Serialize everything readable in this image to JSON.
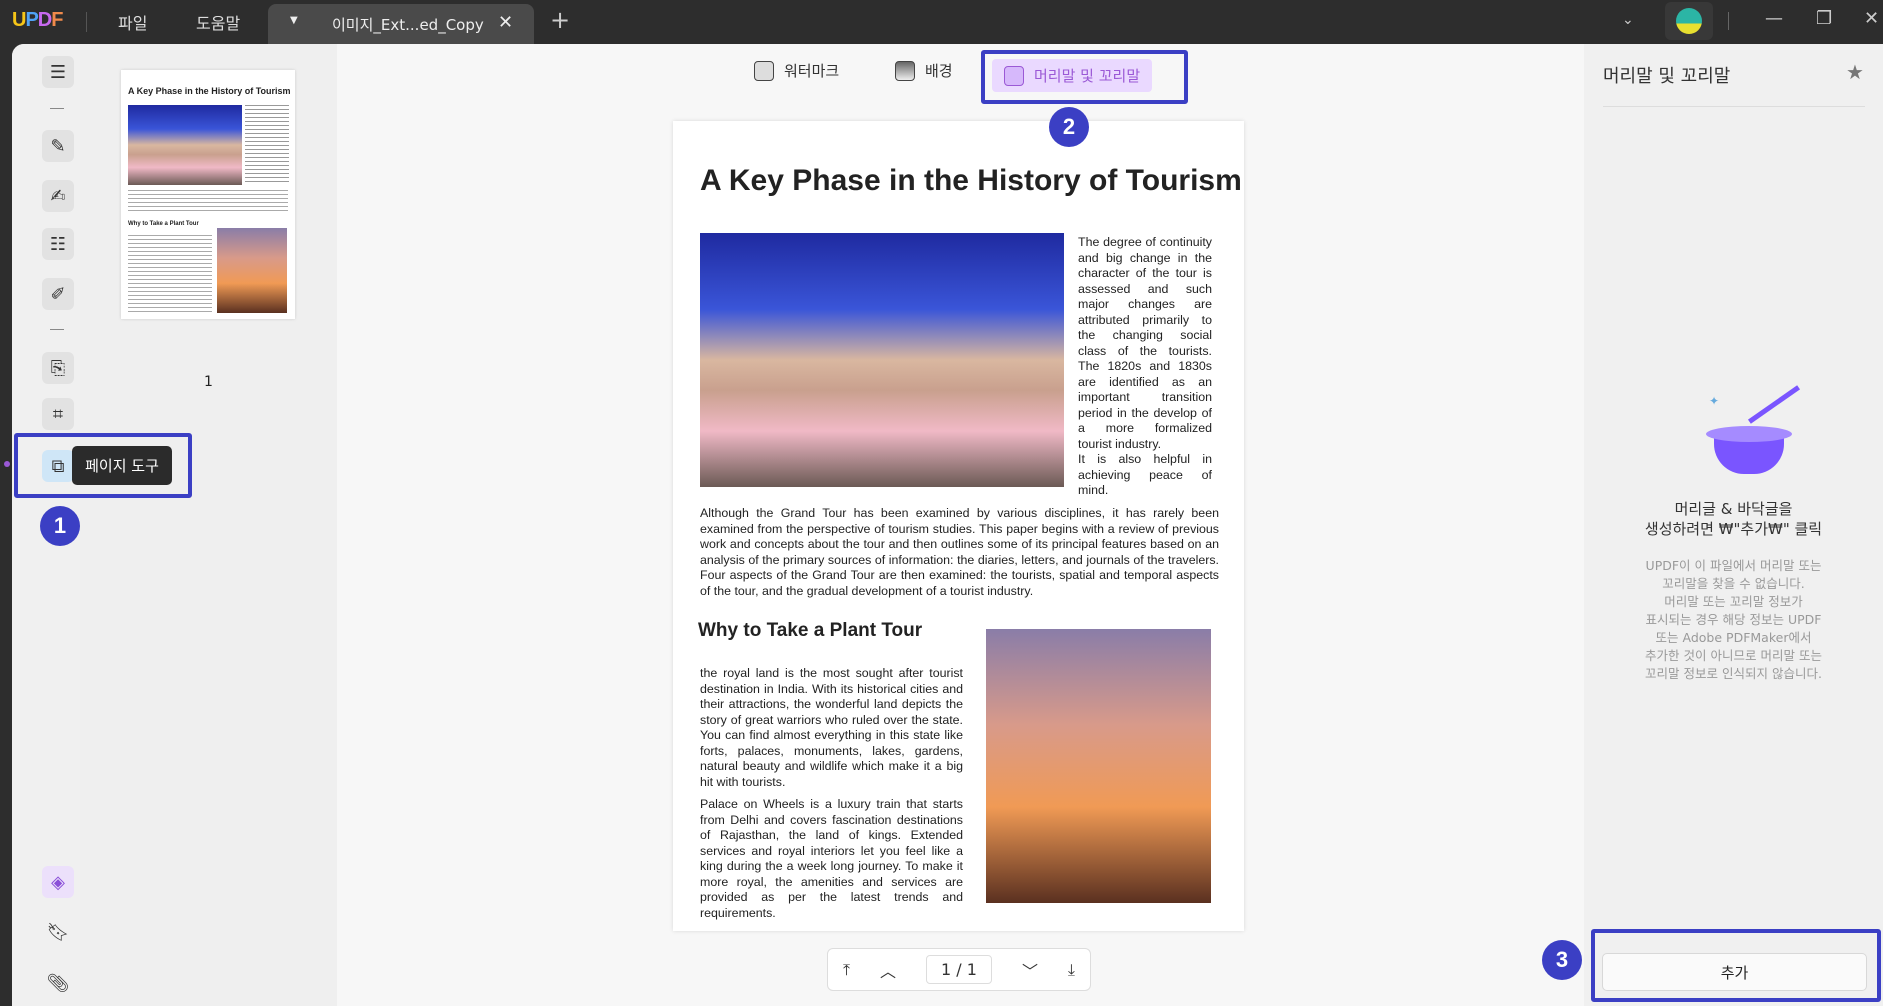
{
  "titlebar": {
    "logo": "UPDF",
    "menu": [
      "파일",
      "도움말"
    ],
    "tab_title": "이미지_Ext...ed_Copy",
    "new_tab": "+"
  },
  "colors": {
    "annotation": "#3b3fc4",
    "active_tab_bg": "#ead9ff",
    "accent": "#9b59d6"
  },
  "left_toolbar": {
    "tooltip": "페이지 도구",
    "active": "page-tools"
  },
  "thumbnails": {
    "pages": [
      {
        "label": "1"
      }
    ]
  },
  "toolbar": {
    "tabs": [
      {
        "label": "워터마크"
      },
      {
        "label": "배경"
      },
      {
        "label": "머리말 및 꼬리말",
        "active": true
      }
    ]
  },
  "document": {
    "title": "A Key Phase in the History of Tourism",
    "side_text": "The degree of continuity and big change in the character of the tour is assessed and such major changes are attributed primarily to the changing social class of the tourists. The 1820s and 1830s are identified as an important transition period in the develop of a more formalized tourist industry.",
    "side_text2": "It is also helpful in achieving peace of mind.",
    "paragraph": "Although the Grand Tour has been examined by various disciplines, it has rarely been examined from the perspective of tourism studies. This paper begins with a review of previous work and concepts about the tour and then outlines some of its principal features based on an analysis of the primary sources of information: the diaries, letters, and journals of the travelers. Four aspects of the Grand Tour are then examined: the tourists, spatial and temporal aspects of the tour, and the gradual development of a tourist industry.",
    "heading2": "Why to Take a Plant Tour",
    "para2": "the royal land is the most sought after tourist destination in India. With its historical cities and their attractions, the wonderful land depicts the story of great warriors who ruled over the state. You can find almost everything in this state like forts, palaces, monuments, lakes, gardens, natural beauty and wildlife which make it a big hit with tourists.",
    "para3": "Palace on Wheels is a luxury train that starts from Delhi and covers fascination destinations of Rajasthan, the land of kings. Extended services and royal interiors let you feel like a king during the a week long journey. To make it more royal, the amenities and services are provided as per the latest trends and requirements."
  },
  "page_nav": {
    "current": "1",
    "separator": "/",
    "total": "1"
  },
  "right_panel": {
    "title": "머리말 및 꼬리말",
    "empty_title_1": "머리글 & 바닥글을",
    "empty_title_2": "생성하려면 ₩\"추가₩\" 클릭",
    "empty_desc": [
      "UPDF이 이 파일에서 머리말 또는",
      "꼬리말을 찾을 수 없습니다.",
      "머리말 또는 꼬리말 정보가",
      "표시되는 경우 해당 정보는 UPDF",
      "또는 Adobe PDFMaker에서",
      "추가한 것이 아니므로 머리말 또는",
      "꼬리말 정보로 인식되지 않습니다."
    ],
    "add_button": "추가"
  },
  "annotations": [
    "1",
    "2",
    "3"
  ]
}
